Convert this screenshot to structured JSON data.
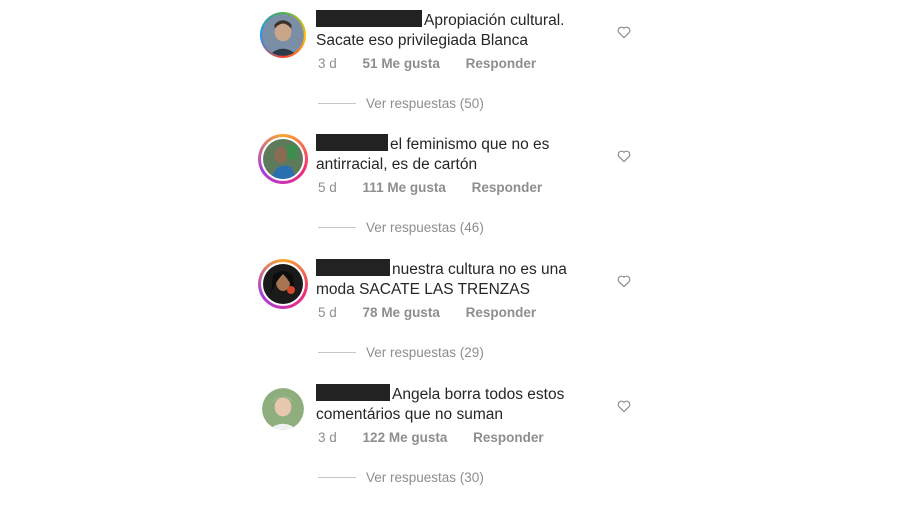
{
  "comments": [
    {
      "text": "Apropiación cultural. Sacate eso privilegiada Blanca",
      "time": "3 d",
      "likes": "51 Me gusta",
      "reply_label": "Responder",
      "view_replies": "Ver respuestas (50)",
      "story_ring": false
    },
    {
      "text": "el feminismo que no es antirracial, es de cartón",
      "time": "5 d",
      "likes": "111 Me gusta",
      "reply_label": "Responder",
      "view_replies": "Ver respuestas (46)",
      "story_ring": true
    },
    {
      "text": "nuestra cultura no es una moda SACATE LAS TRENZAS",
      "time": "5 d",
      "likes": "78 Me gusta",
      "reply_label": "Responder",
      "view_replies": "Ver respuestas (29)",
      "story_ring": true
    },
    {
      "text": "Angela borra todos estos comentários que no suman",
      "time": "3 d",
      "likes": "122 Me gusta",
      "reply_label": "Responder",
      "view_replies": "Ver respuestas (30)",
      "story_ring": false
    }
  ],
  "icons": {
    "like": "heart-outline-icon"
  },
  "colors": {
    "meta": "#8e8e8e",
    "text": "#262626",
    "redaction": "#222222"
  }
}
